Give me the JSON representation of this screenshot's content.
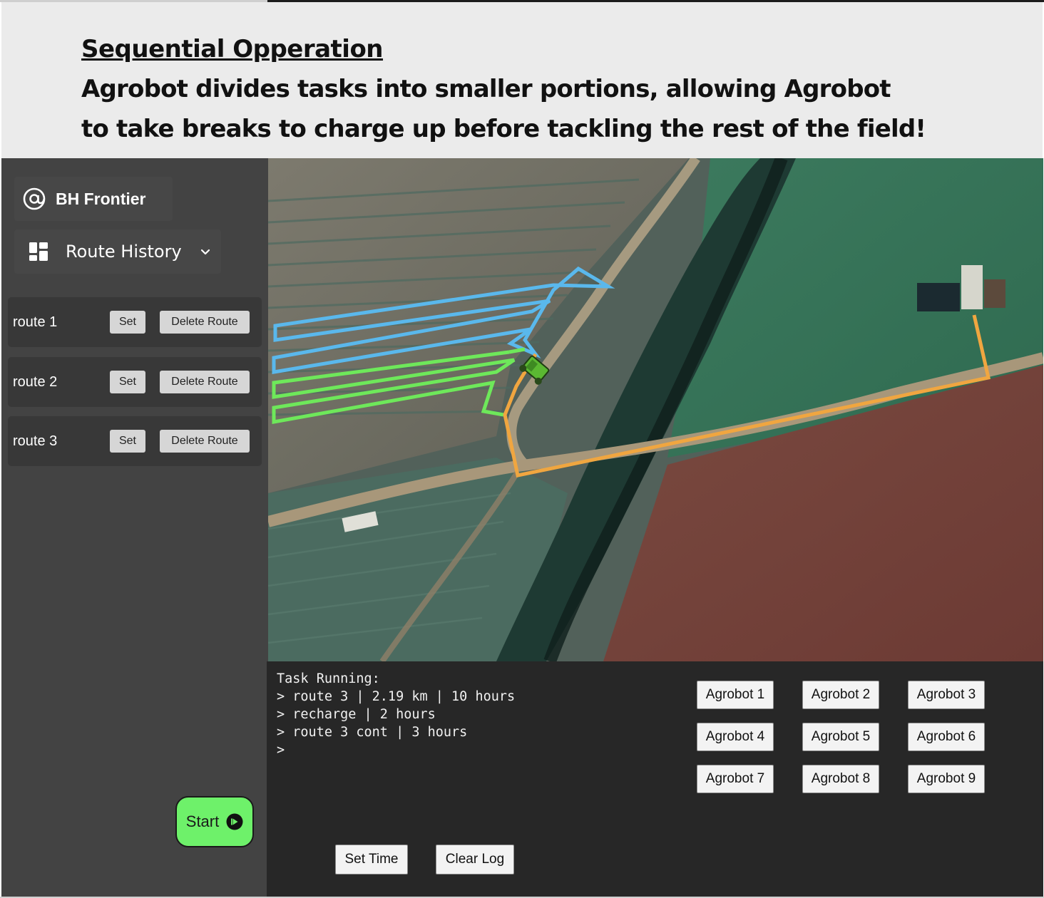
{
  "header": {
    "title": "Sequential Opperation",
    "line1": "Agrobot divides tasks into smaller portions, allowing Agrobot",
    "line2": "to take breaks to charge up before tackling the rest of the field!"
  },
  "sidebar": {
    "brand": "BH Frontier",
    "brand_icon": "at-sign-icon",
    "history_label": "Route History",
    "history_icon": "dashboard-grid-icon",
    "routes": [
      {
        "name": "route 1",
        "set_label": "Set",
        "delete_label": "Delete Route"
      },
      {
        "name": "route 2",
        "set_label": "Set",
        "delete_label": "Delete Route"
      },
      {
        "name": "route 3",
        "set_label": "Set",
        "delete_label": "Delete Route"
      }
    ],
    "start_label": "Start"
  },
  "map": {
    "route_colors": {
      "route_1": "#5ab8ec",
      "route_2": "#6ee85a",
      "route_3": "#f0a640"
    },
    "robot_icon": "tractor-robot-icon"
  },
  "console": {
    "log_lines": [
      "Task Running:",
      "> route 3 | 2.19 km | 10 hours",
      "> recharge | 2 hours",
      "> route 3 cont | 3 hours",
      ">"
    ],
    "agrobots": [
      "Agrobot 1",
      "Agrobot 2",
      "Agrobot 3",
      "Agrobot 4",
      "Agrobot 5",
      "Agrobot 6",
      "Agrobot 7",
      "Agrobot 8",
      "Agrobot 9"
    ],
    "set_time_label": "Set Time",
    "clear_log_label": "Clear Log"
  }
}
